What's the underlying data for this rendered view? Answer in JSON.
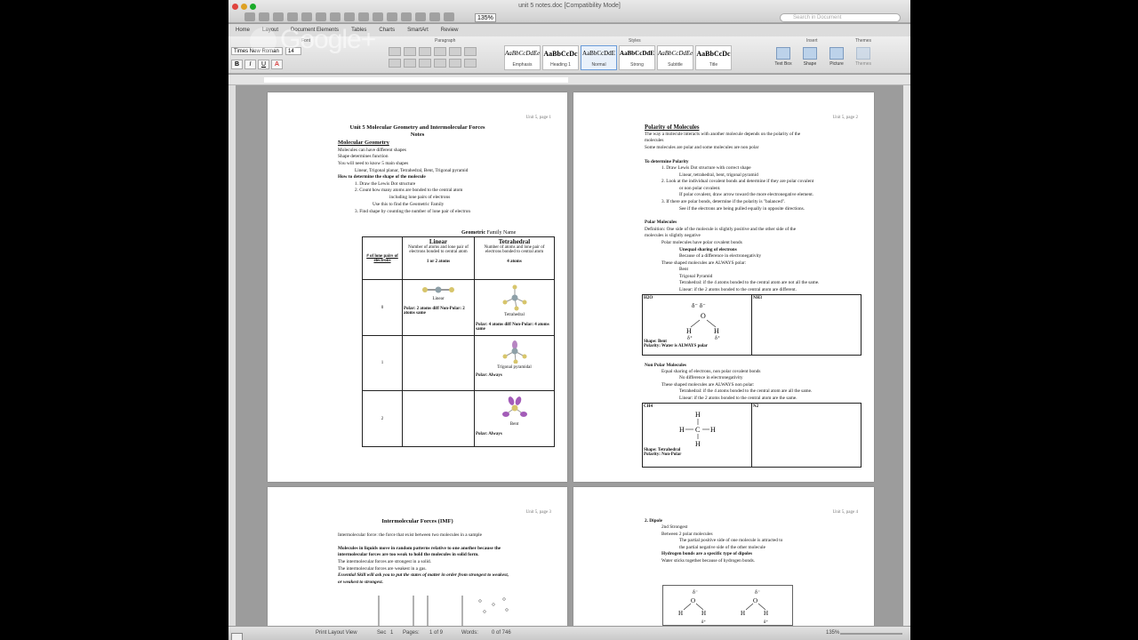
{
  "window": {
    "title": "unit 5 notes.doc [Compatibility Mode]",
    "zoom": "135%",
    "search_placeholder": "Search in Document"
  },
  "ribbon": {
    "tabs": [
      "Home",
      "Layout",
      "Document Elements",
      "Tables",
      "Charts",
      "SmartArt",
      "Review"
    ],
    "group_labels": {
      "font": "Font",
      "paragraph": "Paragraph",
      "styles": "Styles",
      "insert": "Insert",
      "themes": "Themes"
    },
    "font_name": "Times New Roman",
    "font_size": "14",
    "format_buttons": [
      "B",
      "I",
      "U",
      "A"
    ],
    "styles": [
      {
        "sample": "AaBbCcDdEe",
        "name": "Emphasis"
      },
      {
        "sample": "AaBbCcDc",
        "name": "Heading 1"
      },
      {
        "sample": "AaBbCcDdE",
        "name": "Normal"
      },
      {
        "sample": "AaBbCcDdE",
        "name": "Strong"
      },
      {
        "sample": "AaBbCcDdEe",
        "name": "Subtitle"
      },
      {
        "sample": "AaBbCcDc",
        "name": "Title"
      }
    ],
    "insert_items": [
      "Text Box",
      "Shape",
      "Picture",
      "Themes"
    ]
  },
  "watermark": "Google+",
  "page1": {
    "header": "Unit 5, page 1",
    "title": "Unit 5 Molecular Geometry and Intermolecular Forces",
    "subtitle": "Notes",
    "section": "Molecular Geometry",
    "lines": [
      "Molecules can have different shapes",
      "Shape determines function",
      "You will need to know 5 main shapes",
      "Linear, Trigonal planar, Tetrahedral, Bent, Trigonal pyramid",
      "How to determine the shape of the molecule",
      "1.   Draw the Lewis Dot structure",
      "2.   Count how many atoms are bonded to the central atom",
      "including lone pairs of electrons",
      "Use this to find the Geometric Family",
      "3.   Find shape by counting the number of lone pair of electron"
    ],
    "table_caption_bold": "Geometric",
    "table_caption_rest": " Family Name",
    "table": {
      "col0_header": "# of lone pairs of electrons",
      "col1_header": "Linear",
      "col1_sub": "Number of atoms and lone pair of electrons bonded to central atom",
      "col1_count": "1 or 2 atoms",
      "col2_header": "Tetrahedral",
      "col2_sub": "Number of atoms and lone pair of electrons bonded to central atom",
      "col2_count": "4 atoms",
      "rows": [
        {
          "lp": "0",
          "c1_label": "Linear",
          "c1_note": "Polar: 2 atoms diff Non-Polar: 2 atoms same",
          "c2_label": "Tetrahedral",
          "c2_note": "Polar: 4 atoms diff Non-Polar: 4 atoms same"
        },
        {
          "lp": "1",
          "c1_label": "",
          "c1_note": "",
          "c2_label": "Trigonal pyramidal",
          "c2_note": "Polar: Always"
        },
        {
          "lp": "2",
          "c1_label": "",
          "c1_note": "",
          "c2_label": "Bent",
          "c2_note": "Polar: Always"
        }
      ]
    }
  },
  "page2": {
    "header": "Unit 5, page 2",
    "title": "Polarity of Molecules",
    "lines": [
      "The way a molecule interacts with another molecule depends on the polarity of the",
      "molecules",
      "Some molecules are polar and some molecules are non polar",
      "To determine Polarity",
      "1.   Draw Lewis Dot structure with correct shape",
      "Linear, tetrahedral, bent, trigonal pyramid",
      "2.  Look at the individual covalent bonds and determine if they are polar covalent",
      "or non polar covalent.",
      "If polar covalent, draw arrow toward the more electronegative element.",
      "3.  If there are polar bonds, determine if the polarity is \"balanced\".",
      "See if the electrons are being pulled equally in opposite directions.",
      "Polar Molecules",
      "Definition: One side of the molecule is slightly positive and the other side of the",
      "molecules is slightly negative",
      "Polar molecules have polar covalent bonds",
      "Unequal sharing of electrons",
      "Because of a difference in electronegativity",
      "These shaped molecules are ALWAYS polar:",
      "Bent",
      "Trigonal Pyramid",
      "Tetrahedral: if the 4 atoms bonded to the central atom are not all the same.",
      "Linear: if the 2 atoms bonded to the central atom are different."
    ],
    "box1": {
      "left_title": "H2O",
      "right_title": "NH3",
      "shape": "Shape: Bent",
      "polarity": "Polarity: Water is ALWAYS polar"
    },
    "nonpolar_lines": [
      "Non Polar Molecules",
      "Equal sharing of electrons, non polar covalent bonds",
      "No difference in electronegativity",
      "These shaped molecules are ALWAYS non polar:",
      "Tetrahedral: if the 4 atoms bonded to the central atom are all the same.",
      "Linear: if the 2 atoms bonded to the central atom are the same."
    ],
    "box2": {
      "left_title": "CH4",
      "right_title": "N2",
      "shape": "Shape: Tetrahedral",
      "polarity": "Polarity: Non-Polar"
    }
  },
  "page3": {
    "header": "Unit 5, page 3",
    "title": "Intermolecular Forces (IMF)",
    "lines": [
      "Intermolecular force:  the force that exist between two molecules in a sample",
      "Molecules in liquids move in random patterns relative to one another because the",
      "intermolecular forces are too weak to hold the molecules in solid form.",
      "The intermolecular forces are strongest in a solid.",
      "The intermolecular forces are weakest in a gas.",
      "Essential Skill will ask you to put the states of matter in order from strongest to weakest,",
      "or weakest to strongest."
    ]
  },
  "page4": {
    "header": "Unit 5, page 4",
    "lines": [
      "2.  Dipole",
      "2nd Strongest",
      "Between 2 polar molecules",
      "The partial positive side of one molecule is attracted to",
      "the partial negative side of the other molecule",
      "Hydrogen bonds are a specific type of dipoles",
      "Water sticks together because of hydrogen bonds."
    ]
  },
  "status": {
    "view": "Print Layout View",
    "sec_label": "Sec",
    "sec": "1",
    "pages_label": "Pages:",
    "pages": "1 of 9",
    "words_label": "Words:",
    "words": "0 of 746",
    "zoom": "135%"
  }
}
